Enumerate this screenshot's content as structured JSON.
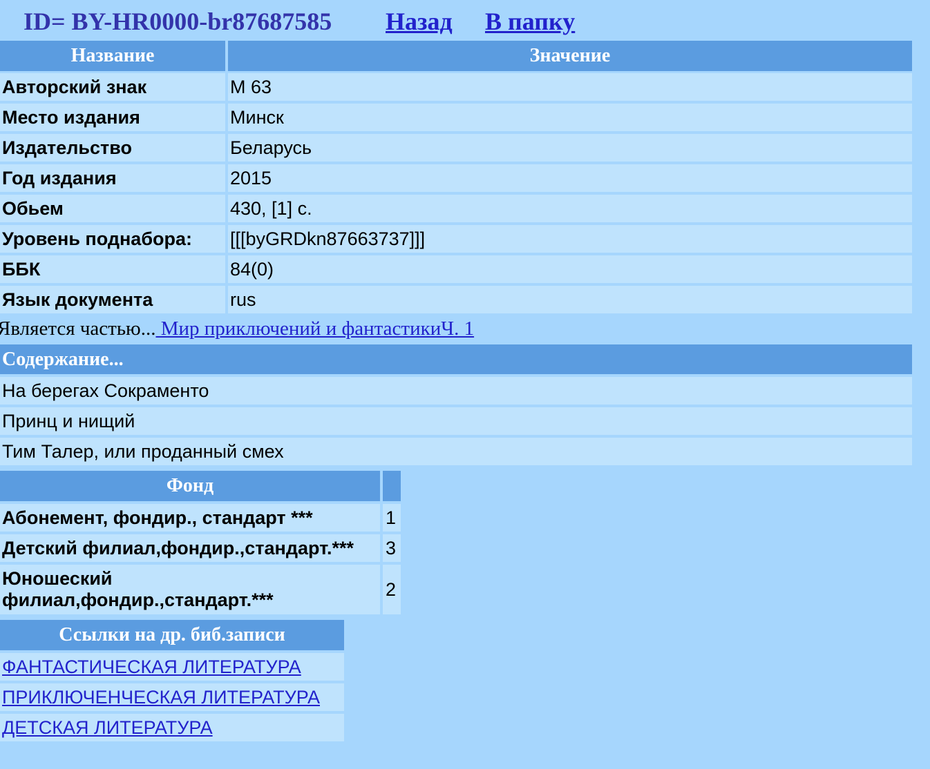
{
  "header": {
    "id_text": "ID= BY-HR0000-br87687585",
    "back_link": "Назад",
    "folder_link": "В папку"
  },
  "record_table": {
    "col_name": "Название",
    "col_value": "Значение",
    "rows": [
      {
        "name": "Авторский знак",
        "value": "М 63"
      },
      {
        "name": "Место издания",
        "value": "Минск"
      },
      {
        "name": "Издательство",
        "value": "Беларусь"
      },
      {
        "name": "Год издания",
        "value": "2015"
      },
      {
        "name": "Обьем",
        "value": "430, [1] с."
      },
      {
        "name": "Уровень поднабора:",
        "value": "[[[byGRDkn87663737]]]"
      },
      {
        "name": "ББК",
        "value": "84(0)"
      },
      {
        "name": "Язык документа",
        "value": "rus"
      }
    ]
  },
  "part_of": {
    "prefix": "Является частью...",
    "link": " Мир приключений и фантастикиЧ. 1"
  },
  "contents": {
    "header": "Содержание...",
    "items": [
      "На берегах Сокраменто",
      "Принц и нищий",
      "Тим Талер, или проданный смех"
    ]
  },
  "fund": {
    "header": "Фонд",
    "rows": [
      {
        "name": "Абонемент, фондир., стандарт ***",
        "count": "1"
      },
      {
        "name": "Детский филиал,фондир.,стандарт.***",
        "count": "3"
      },
      {
        "name": "Юношеский филиал,фондир.,стандарт.***",
        "count": "2"
      }
    ]
  },
  "links": {
    "header": "Ссылки на др. биб.записи",
    "items": [
      "ФАНТАСТИЧЕСКАЯ ЛИТЕРАТУРА",
      "ПРИКЛЮЧЕНЧЕСКАЯ ЛИТЕРАТУРА",
      "ДЕТСКАЯ ЛИТЕРАТУРА"
    ]
  }
}
